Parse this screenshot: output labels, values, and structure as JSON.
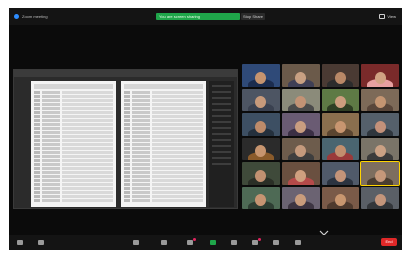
{
  "topbar": {
    "app_label": "Zoom meeting",
    "share_banner": "You are screen sharing",
    "stop_share": "Stop Share",
    "view_label": "View"
  },
  "toolbar": {
    "items": [
      "mute",
      "video",
      "security",
      "participants",
      "chat",
      "share",
      "record",
      "reactions",
      "apps",
      "more"
    ],
    "end_label": "End"
  },
  "colors": {
    "background": "#0b0b0b",
    "share_green": "#1fa64a",
    "end_red": "#e02828",
    "active_speaker": "#ffd400"
  },
  "gallery": {
    "tiles": [
      {
        "bg": "#2f4a78",
        "shirt": "#1b2c4e",
        "skin": "#c6946f"
      },
      {
        "bg": "#6b5a4a",
        "shirt": "#3f3f55",
        "skin": "#c8a082"
      },
      {
        "bg": "#4a3a33",
        "shirt": "#2c2c2c",
        "skin": "#b98867"
      },
      {
        "bg": "#7a2a2a",
        "shirt": "#e6a0a0",
        "skin": "#d1a283"
      },
      {
        "bg": "#4d5563",
        "shirt": "#3a4150",
        "skin": "#c79a7b"
      },
      {
        "bg": "#8b8b7a",
        "shirt": "#4b4b4b",
        "skin": "#c39375"
      },
      {
        "bg": "#5e7a45",
        "shirt": "#2f3f24",
        "skin": "#cc9d7e"
      },
      {
        "bg": "#7d6a58",
        "shirt": "#59463a",
        "skin": "#c49572"
      },
      {
        "bg": "#3d4f63",
        "shirt": "#24303d",
        "skin": "#bd8b6a"
      },
      {
        "bg": "#6a5b73",
        "shirt": "#3b2f44",
        "skin": "#c99d80"
      },
      {
        "bg": "#8a6f4e",
        "shirt": "#5a4530",
        "skin": "#c89670"
      },
      {
        "bg": "#55606b",
        "shirt": "#2f363d",
        "skin": "#c3917a"
      },
      {
        "bg": "#2b2b2b",
        "shirt": "#8a5b2b",
        "skin": "#c7956f"
      },
      {
        "bg": "#6d5c4c",
        "shirt": "#3e3e3e",
        "skin": "#c49a7d"
      },
      {
        "bg": "#4a6570",
        "shirt": "#9a3a3a",
        "skin": "#c28f6e"
      },
      {
        "bg": "#7a7468",
        "shirt": "#3b3b3b",
        "skin": "#caa184"
      },
      {
        "bg": "#3f4a3a",
        "shirt": "#2a2f26",
        "skin": "#c19171"
      },
      {
        "bg": "#6a5040",
        "shirt": "#b54a4a",
        "skin": "#cf9f7f"
      },
      {
        "bg": "#505a6a",
        "shirt": "#2b3340",
        "skin": "#c49479"
      },
      {
        "bg": "#7d6e5f",
        "shirt": "#4a3d31",
        "skin": "#c5987a"
      },
      {
        "bg": "#4e6a55",
        "shirt": "#2e3e33",
        "skin": "#c69472"
      },
      {
        "bg": "#6b6372",
        "shirt": "#3d3542",
        "skin": "#c99c7c"
      },
      {
        "bg": "#7a5a48",
        "shirt": "#4e3a2e",
        "skin": "#c8966f"
      },
      {
        "bg": "#5a5f66",
        "shirt": "#33363a",
        "skin": "#c3957b"
      }
    ],
    "active_speaker_index": 19
  }
}
